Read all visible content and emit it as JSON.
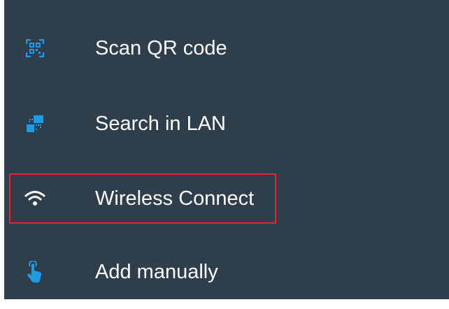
{
  "menu": {
    "items": [
      {
        "label": "Scan QR code",
        "icon": "qr-code-icon"
      },
      {
        "label": "Search in LAN",
        "icon": "lan-search-icon"
      },
      {
        "label": "Wireless Connect",
        "icon": "wifi-icon",
        "highlighted": true
      },
      {
        "label": "Add manually",
        "icon": "touch-hand-icon"
      }
    ]
  },
  "colors": {
    "background": "#2e3e4a",
    "icon": "#1e9be4",
    "text": "#ffffff",
    "highlight": "#e0262e"
  }
}
